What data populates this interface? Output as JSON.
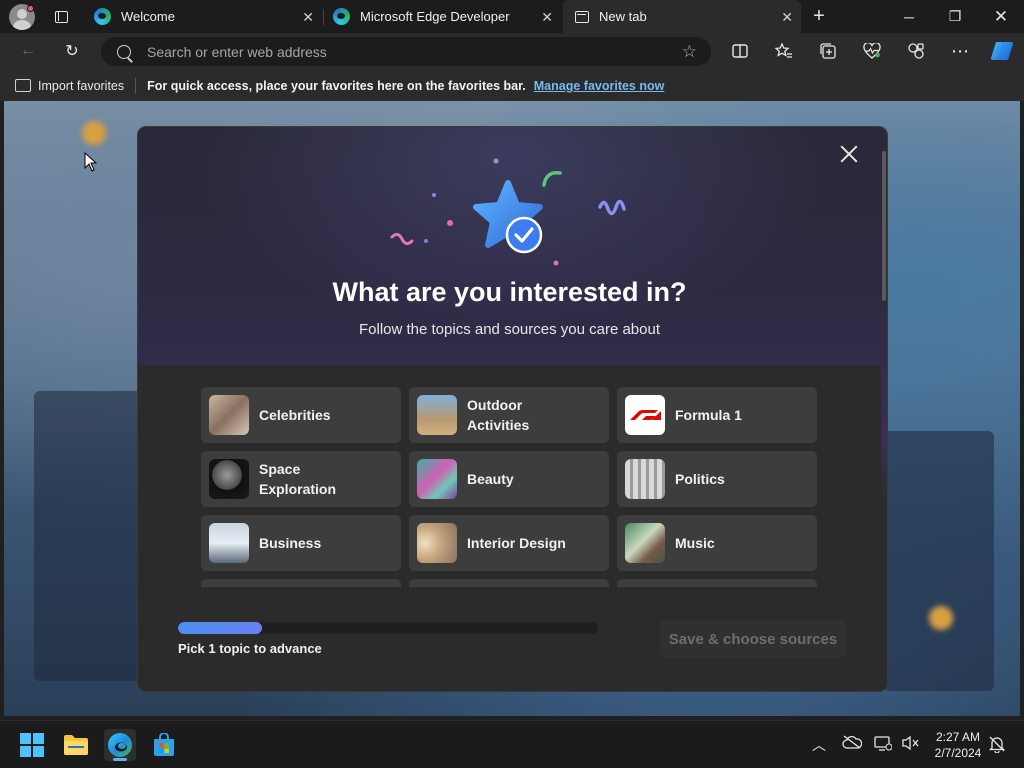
{
  "tabs": [
    {
      "title": "Welcome",
      "active": false
    },
    {
      "title": "Microsoft Edge Developer",
      "active": false
    },
    {
      "title": "New tab",
      "active": true
    }
  ],
  "toolbar": {
    "address_placeholder": "Search or enter web address"
  },
  "favorites_bar": {
    "import_label": "Import favorites",
    "message": "For quick access, place your favorites here on the favorites bar.",
    "link": "Manage favorites now"
  },
  "dialog": {
    "title": "What are you interested in?",
    "subtitle": "Follow the topics and sources you care about",
    "topics": [
      {
        "label": "Celebrities"
      },
      {
        "label": "Outdoor Activities"
      },
      {
        "label": "Formula 1"
      },
      {
        "label": "Space Exploration"
      },
      {
        "label": "Beauty"
      },
      {
        "label": "Politics"
      },
      {
        "label": "Business"
      },
      {
        "label": "Interior Design"
      },
      {
        "label": "Music"
      }
    ],
    "progress_fraction": 0.2,
    "hint": "Pick 1 topic to advance",
    "save_label": "Save & choose sources"
  },
  "clock": {
    "time": "2:27 AM",
    "date": "2/7/2024"
  }
}
